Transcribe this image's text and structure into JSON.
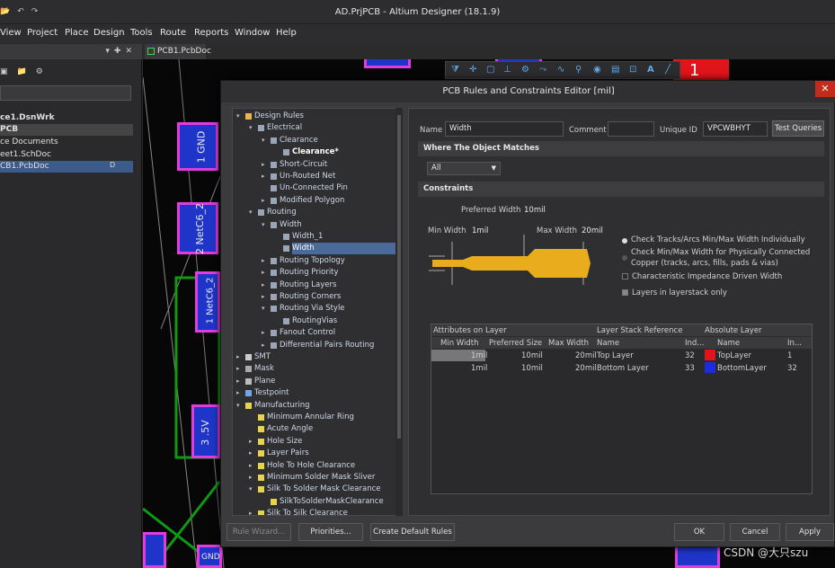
{
  "app": {
    "title": "AD.PrjPCB - Altium Designer (18.1.9)"
  },
  "menu": [
    "View",
    "Project",
    "Place",
    "Design",
    "Tools",
    "Route",
    "Reports",
    "Window",
    "Help"
  ],
  "projects_panel": {
    "items": [
      {
        "label": "ce1.DsnWrk",
        "style": "bold"
      },
      {
        "label": "PCB",
        "style": "bold-dk"
      },
      {
        "label": "ce Documents",
        "style": ""
      },
      {
        "label": "eet1.SchDoc",
        "style": ""
      },
      {
        "label": "CB1.PcbDoc",
        "style": "sel"
      }
    ]
  },
  "doc_tab": {
    "label": "PCB1.PcbDoc"
  },
  "pcb": {
    "pad_labels": [
      "1 GND",
      "2 NetC6_2",
      "1 NetC6_2",
      "3 .5V",
      "GND"
    ],
    "red_label": "1"
  },
  "dialog": {
    "title": "PCB Rules and Constraints Editor [mil]",
    "close": "✕",
    "tree": [
      {
        "label": "Design Rules",
        "level": 0,
        "arrow": "▾",
        "icon": "folder"
      },
      {
        "label": "Electrical",
        "level": 1,
        "arrow": "▾",
        "icon": "rule"
      },
      {
        "label": "Clearance",
        "level": 2,
        "arrow": "▾",
        "icon": "rule"
      },
      {
        "label": "Clearance*",
        "level": 3,
        "arrow": "",
        "icon": "rule",
        "style": "b"
      },
      {
        "label": "Short-Circuit",
        "level": 2,
        "arrow": "▸",
        "icon": "rule"
      },
      {
        "label": "Un-Routed Net",
        "level": 2,
        "arrow": "▸",
        "icon": "rule"
      },
      {
        "label": "Un-Connected Pin",
        "level": 2,
        "arrow": "",
        "icon": "rule"
      },
      {
        "label": "Modified Polygon",
        "level": 2,
        "arrow": "▸",
        "icon": "rule"
      },
      {
        "label": "Routing",
        "level": 1,
        "arrow": "▾",
        "icon": "route"
      },
      {
        "label": "Width",
        "level": 2,
        "arrow": "▾",
        "icon": "route"
      },
      {
        "label": "Width_1",
        "level": 3,
        "arrow": "",
        "icon": "route"
      },
      {
        "label": "Width",
        "level": 3,
        "arrow": "",
        "icon": "route",
        "style": "sel"
      },
      {
        "label": "Routing Topology",
        "level": 2,
        "arrow": "▸",
        "icon": "route"
      },
      {
        "label": "Routing Priority",
        "level": 2,
        "arrow": "▸",
        "icon": "route"
      },
      {
        "label": "Routing Layers",
        "level": 2,
        "arrow": "▸",
        "icon": "route"
      },
      {
        "label": "Routing Corners",
        "level": 2,
        "arrow": "▸",
        "icon": "route"
      },
      {
        "label": "Routing Via Style",
        "level": 2,
        "arrow": "▾",
        "icon": "route"
      },
      {
        "label": "RoutingVias",
        "level": 3,
        "arrow": "",
        "icon": "route"
      },
      {
        "label": "Fanout Control",
        "level": 2,
        "arrow": "▸",
        "icon": "route"
      },
      {
        "label": "Differential Pairs Routing",
        "level": 2,
        "arrow": "▸",
        "icon": "route"
      },
      {
        "label": "SMT",
        "level": 0,
        "arrow": "▸",
        "icon": "smt"
      },
      {
        "label": "Mask",
        "level": 0,
        "arrow": "▸",
        "icon": "mask"
      },
      {
        "label": "Plane",
        "level": 0,
        "arrow": "▸",
        "icon": "plane"
      },
      {
        "label": "Testpoint",
        "level": 0,
        "arrow": "▸",
        "icon": "test"
      },
      {
        "label": "Manufacturing",
        "level": 0,
        "arrow": "▾",
        "icon": "mfg"
      },
      {
        "label": "Minimum Annular Ring",
        "level": 1,
        "arrow": "",
        "icon": "mfg"
      },
      {
        "label": "Acute Angle",
        "level": 1,
        "arrow": "",
        "icon": "mfg"
      },
      {
        "label": "Hole Size",
        "level": 1,
        "arrow": "▸",
        "icon": "mfg"
      },
      {
        "label": "Layer Pairs",
        "level": 1,
        "arrow": "▸",
        "icon": "mfg"
      },
      {
        "label": "Hole To Hole Clearance",
        "level": 1,
        "arrow": "▸",
        "icon": "mfg"
      },
      {
        "label": "Minimum Solder Mask Sliver",
        "level": 1,
        "arrow": "▸",
        "icon": "mfg"
      },
      {
        "label": "Silk To Solder Mask Clearance",
        "level": 1,
        "arrow": "▾",
        "icon": "mfg"
      },
      {
        "label": "SilkToSolderMaskClearance",
        "level": 2,
        "arrow": "",
        "icon": "mfg"
      },
      {
        "label": "Silk To Silk Clearance",
        "level": 1,
        "arrow": "▸",
        "icon": "mfg"
      }
    ],
    "name_label": "Name",
    "name_value": "Width",
    "comment_label": "Comment",
    "comment_value": "",
    "uid_label": "Unique ID",
    "uid_value": "VPCWBHYT",
    "test_queries": "Test Queries",
    "where_header": "Where The Object Matches",
    "where_value": "All",
    "constraints_header": "Constraints",
    "preferred_label": "Preferred Width",
    "preferred_value": "10mil",
    "min_label": "Min Width",
    "min_value": "1mil",
    "max_label": "Max Width",
    "max_value": "20mil",
    "opt_individual": "Check Tracks/Arcs Min/Max Width Individually",
    "opt_copper_1": "Check Min/Max Width for Physically Connected",
    "opt_copper_2": "Copper (tracks, arcs, fills, pads & vias)",
    "opt_impedance": "Characteristic Impedance Driven Width",
    "opt_layerstack": "Layers in layerstack only",
    "table": {
      "group_headers": [
        "Attributes on Layer",
        "Layer Stack Reference",
        "Absolute Layer"
      ],
      "columns": [
        "Min Width",
        "Preferred Size",
        "Max Width",
        "Name",
        "Ind...",
        "Name",
        "In..."
      ],
      "rows": [
        {
          "min": "1mil",
          "pref": "10mil",
          "max": "20mil",
          "name": "Top Layer",
          "ind": "32",
          "abs_name": "TopLayer",
          "abs_ind": "1",
          "color": "#e0141a"
        },
        {
          "min": "1mil",
          "pref": "10mil",
          "max": "20mil",
          "name": "Bottom Layer",
          "ind": "33",
          "abs_name": "BottomLayer",
          "abs_ind": "32",
          "color": "#1a2cdc"
        }
      ]
    },
    "buttons": {
      "wizard": "Rule Wizard...",
      "priorities": "Priorities...",
      "create_default": "Create Default Rules",
      "ok": "OK",
      "cancel": "Cancel",
      "apply": "Apply"
    }
  },
  "watermark": "CSDN @大只szu"
}
